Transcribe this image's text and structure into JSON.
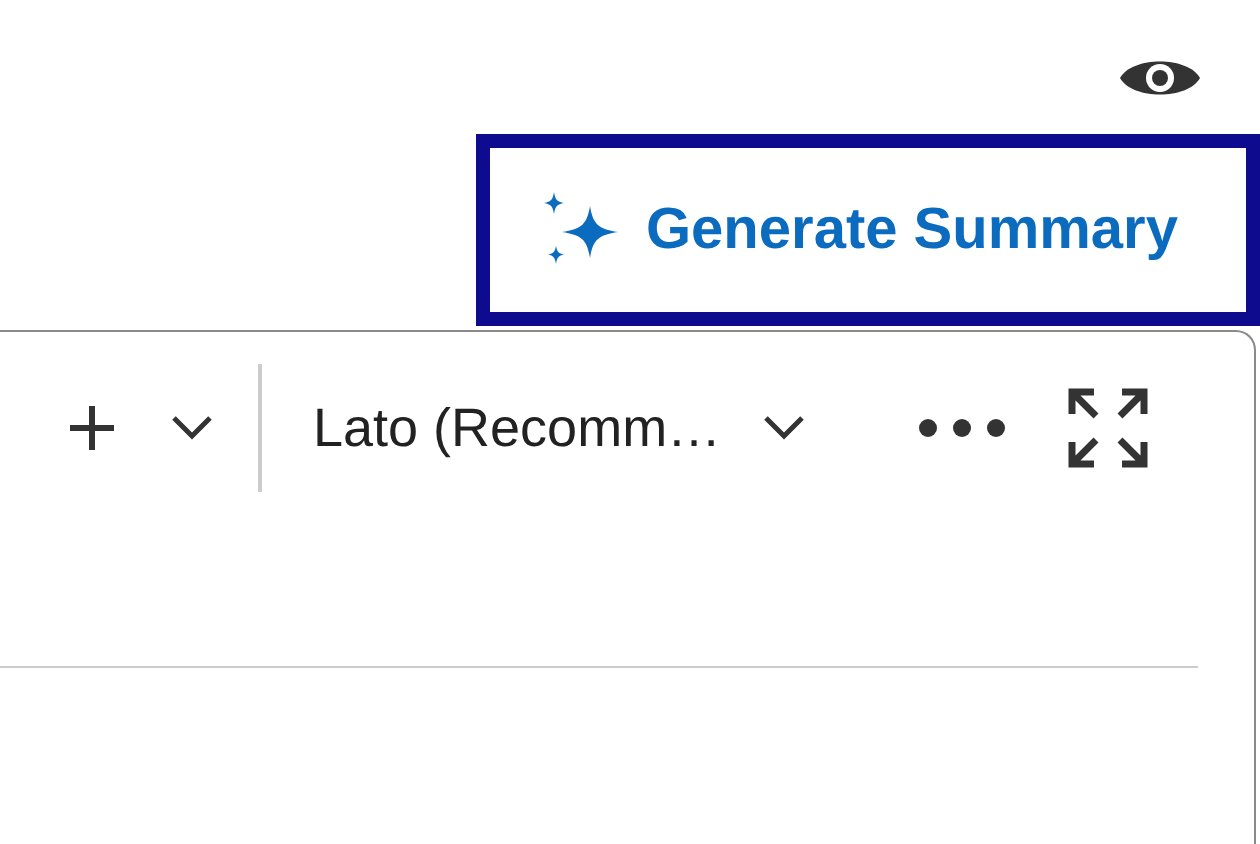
{
  "header": {
    "preview_visible": true
  },
  "summary_button": {
    "label": "Generate Summary",
    "focused": true
  },
  "editor": {
    "toolbar": {
      "font_select": {
        "value": "Lato (Recomm…"
      }
    }
  }
}
